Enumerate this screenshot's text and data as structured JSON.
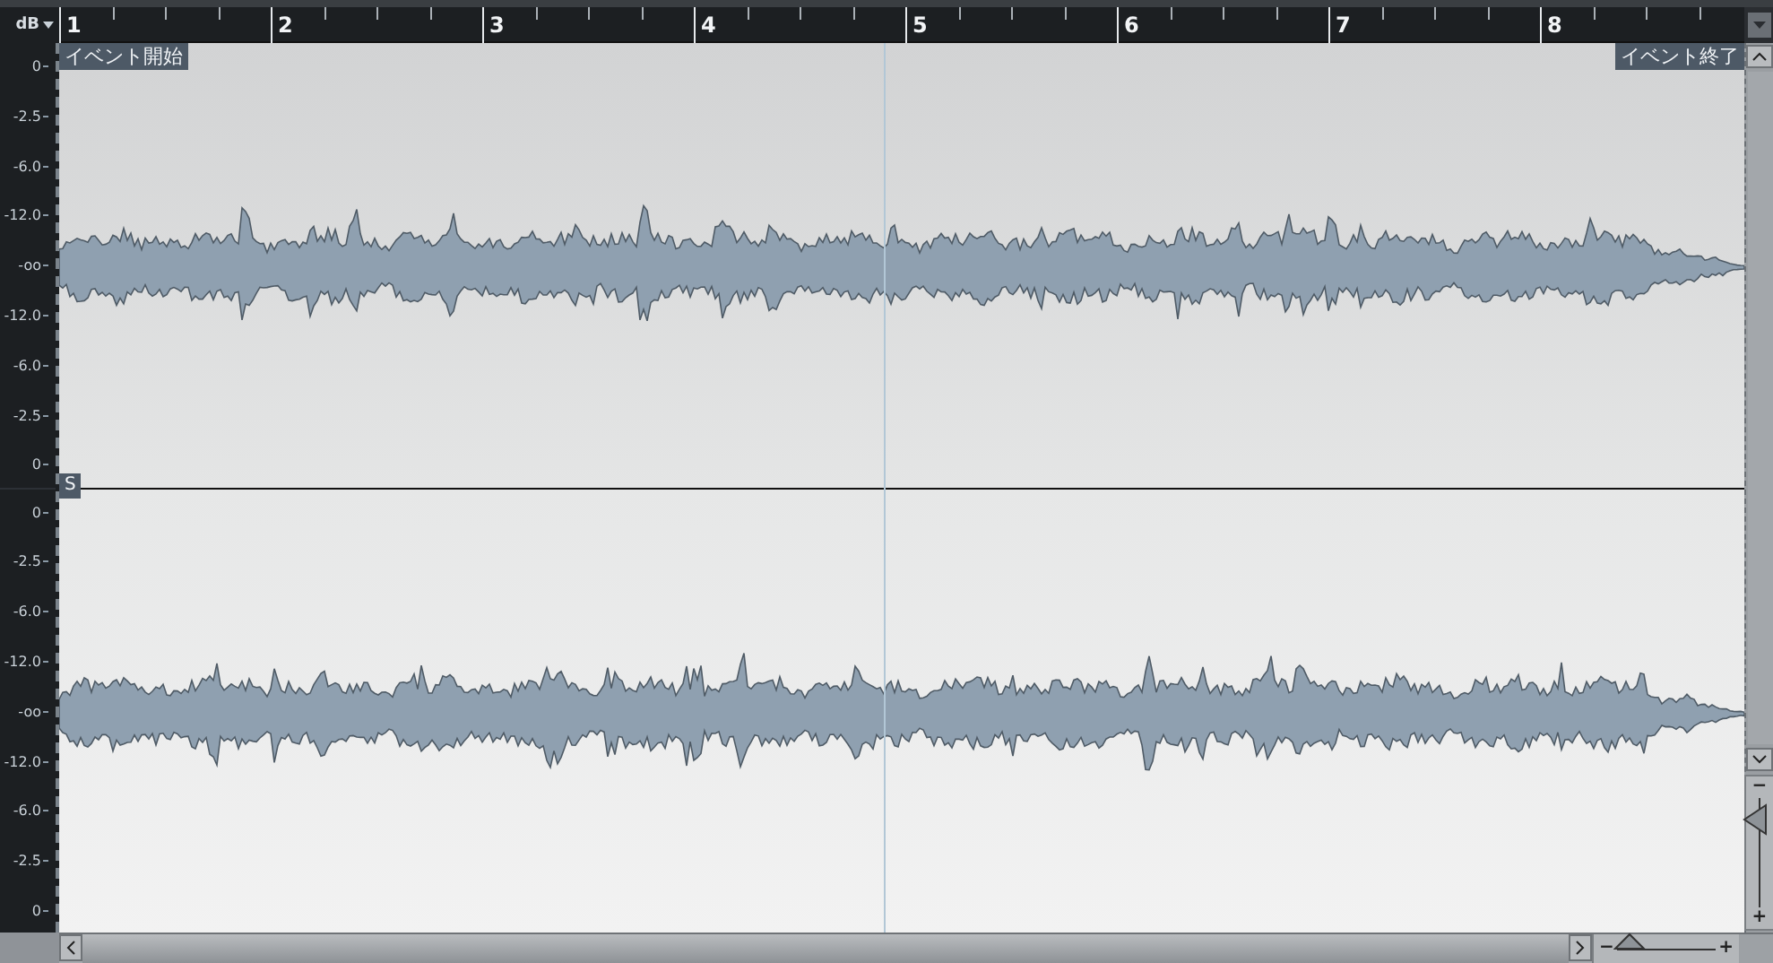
{
  "scale": {
    "unit": "dB"
  },
  "ruler": {
    "bars": [
      "1",
      "2",
      "3",
      "4",
      "5",
      "6",
      "7",
      "8"
    ]
  },
  "markers": {
    "start": "イベント開始",
    "end": "イベント終了",
    "sync": "S"
  },
  "channels": [
    {
      "scale_labels": [
        "0",
        "-2.5",
        "-6.0",
        "-12.0",
        "-oo",
        "-12.0",
        "-6.0",
        "-2.5",
        "0"
      ]
    },
    {
      "scale_labels": [
        "0",
        "-2.5",
        "-6.0",
        "-12.0",
        "-oo",
        "-12.0",
        "-6.0",
        "-2.5",
        "0"
      ]
    }
  ],
  "zoom": {
    "horizontal": {
      "level": 0.12,
      "minus": "−",
      "plus": "+"
    },
    "vertical": {
      "minus": "−",
      "plus": "+"
    }
  }
}
